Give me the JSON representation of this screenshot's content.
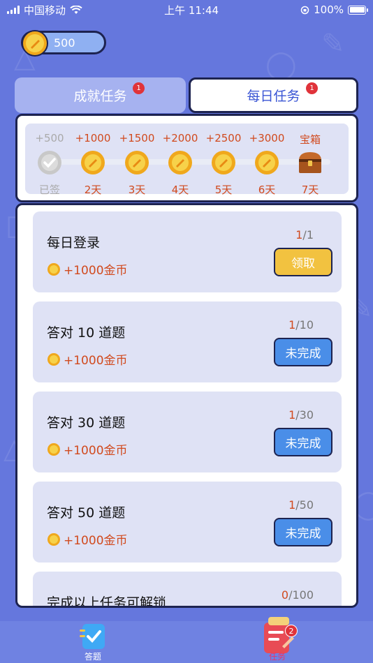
{
  "status_bar": {
    "carrier": "中国移动",
    "time": "上午 11:44",
    "battery": "100%"
  },
  "coin_balance": "500",
  "tabs": [
    {
      "label": "成就任务",
      "badge": "1",
      "active": false
    },
    {
      "label": "每日任务",
      "badge": "1",
      "active": true
    }
  ],
  "signin": [
    {
      "amount": "+500",
      "label": "已签",
      "done": true
    },
    {
      "amount": "+1000",
      "label": "2天",
      "done": false
    },
    {
      "amount": "+1500",
      "label": "3天",
      "done": false
    },
    {
      "amount": "+2000",
      "label": "4天",
      "done": false
    },
    {
      "amount": "+2500",
      "label": "5天",
      "done": false
    },
    {
      "amount": "+3000",
      "label": "6天",
      "done": false
    },
    {
      "amount": "宝箱",
      "label": "7天",
      "done": false,
      "chest": true
    }
  ],
  "tasks": [
    {
      "title": "每日登录",
      "reward": "+1000金币",
      "current": "1",
      "total": "/1",
      "button": "领取",
      "state": "claim"
    },
    {
      "title": "答对 10 道题",
      "reward": "+1000金币",
      "current": "1",
      "total": "/10",
      "button": "未完成",
      "state": "pending"
    },
    {
      "title": "答对 30 道题",
      "reward": "+1000金币",
      "current": "1",
      "total": "/30",
      "button": "未完成",
      "state": "pending"
    },
    {
      "title": "答对 50 道题",
      "reward": "+1000金币",
      "current": "1",
      "total": "/50",
      "button": "未完成",
      "state": "pending"
    },
    {
      "title": "完成以上任务可解锁",
      "reward": "",
      "current": "0",
      "total": "/100",
      "button": "",
      "state": "partial"
    }
  ],
  "bottom_nav": {
    "quiz_label": "答题",
    "task_label": "任务",
    "task_badge": "2"
  },
  "colors": {
    "background": "#6577dd",
    "accent_red": "#d14a1e",
    "button_blue": "#4a8ee8",
    "button_gold": "#f2c240",
    "outline": "#1d2350"
  }
}
